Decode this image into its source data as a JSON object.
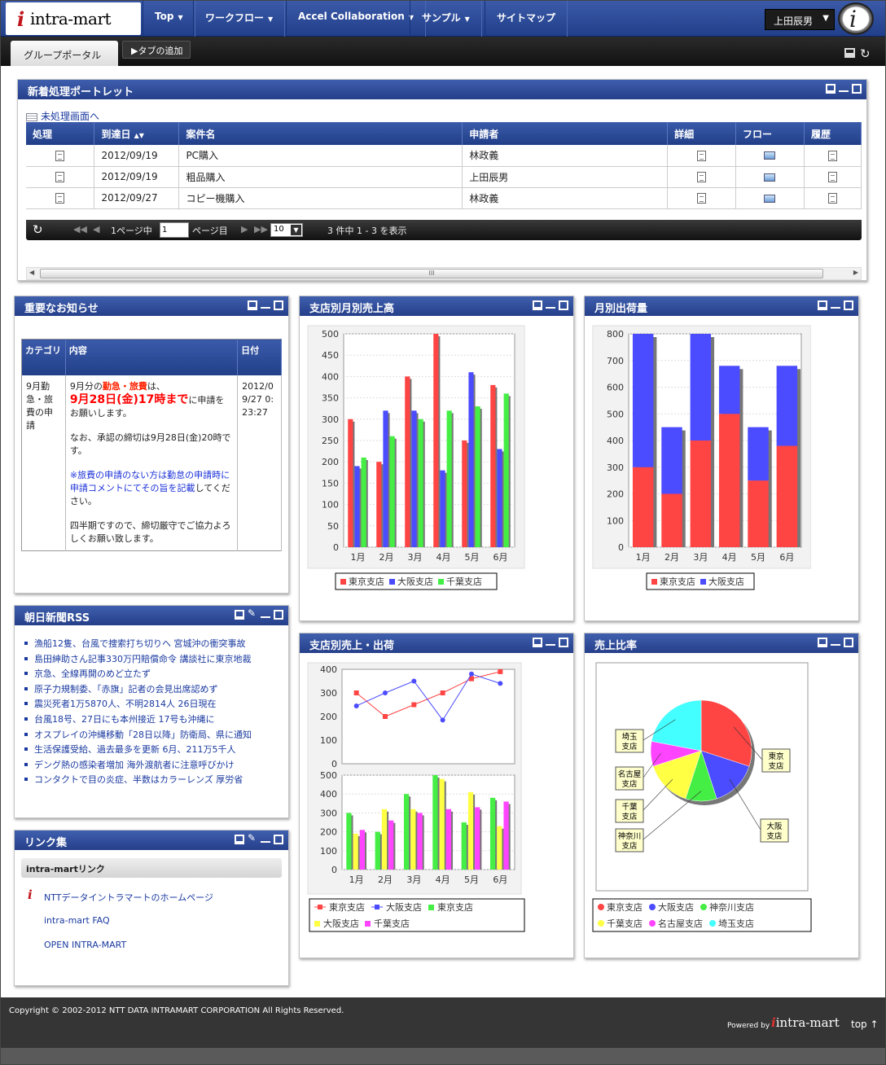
{
  "nav": {
    "logo": "intra-mart",
    "items": [
      "Top",
      "ワークフロー",
      "Accel Collaboration",
      "サンプル",
      "サイトマップ"
    ],
    "user": "上田辰男"
  },
  "tabs": {
    "portal": "グループポータル",
    "add": "▶タブの追加"
  },
  "pending": {
    "title": "新着処理ポートレット",
    "link": "未処理画面へ",
    "columns": [
      "処理",
      "到達日",
      "案件名",
      "申請者",
      "詳細",
      "フロー",
      "履歴"
    ],
    "rows": [
      {
        "date": "2012/09/19",
        "name": "PC購入",
        "applicant": "林政義"
      },
      {
        "date": "2012/09/19",
        "name": "粗品購入",
        "applicant": "上田辰男"
      },
      {
        "date": "2012/09/27",
        "name": "コピー機購入",
        "applicant": "林政義"
      }
    ],
    "pager": {
      "page_label": "1ページ中",
      "page_value": "1",
      "page_suffix": "ページ目",
      "per_page": "10",
      "summary": "3 件中 1 - 3 を表示"
    },
    "scroll_mark": "III"
  },
  "notice": {
    "title": "重要なお知らせ",
    "columns": [
      "カテゴリ",
      "内容",
      "日付"
    ],
    "category": "9月勤急・旅費の申請",
    "line1_a": "9月分の",
    "line1_b": "勤急・旅費",
    "line1_c": "は、",
    "line2_a": "9月28日(金)17時まで",
    "line2_b": "に申請をお願いします。",
    "para2": "なお、承認の締切は9月28日(金)20時です。",
    "para3": "※旅費の申請のない方は勤怠の申請時に申請コメントにてその旨を記載",
    "para3_b": "してください。",
    "para4": "四半期ですので、締切厳守でご協力よろしくお願い致します。",
    "date": "2012/09/27 0:23:27"
  },
  "rss": {
    "title": "朝日新聞RSS",
    "items": [
      "漁船12隻、台風で捜索打ち切りへ 宮城沖の衝突事故",
      "島田紳助さん記事330万円賠償命令 講談社に東京地裁",
      "京急、全線再開のめど立たず",
      "原子力規制委、「赤旗」記者の会見出席認めず",
      "震災死者1万5870人、不明2814人 26日現在",
      "台風18号、27日にも本州接近 17号も沖縄に",
      "オスプレイの沖縄移動「28日以降」防衛局、県に通知",
      "生活保護受給、過去最多を更新 6月、211万5千人",
      "デング熱の感染者増加 海外渡航者に注意呼びかけ",
      "コンタクトで目の炎症、半数はカラーレンズ 厚労省"
    ]
  },
  "links": {
    "title": "リンク集",
    "group": "intra-martリンク",
    "items": [
      "NTTデータイントラマートのホームページ",
      "intra-mart FAQ",
      "OPEN INTRA-MART"
    ]
  },
  "chart_titles": {
    "sales": "支店別月別売上高",
    "shipping": "月別出荷量",
    "combined": "支店別売上・出荷",
    "ratio": "売上比率"
  },
  "colors": {
    "red": "#ff4444",
    "blue": "#4b4bff",
    "green": "#44ee44",
    "yellow": "#ffff44",
    "magenta": "#ff44ff",
    "cyan": "#44ffff"
  },
  "chart_data": [
    {
      "type": "bar",
      "title": "支店別月別売上高",
      "categories": [
        "1月",
        "2月",
        "3月",
        "4月",
        "5月",
        "6月"
      ],
      "ylim": [
        0,
        500
      ],
      "yticks": [
        0,
        50,
        100,
        150,
        200,
        250,
        300,
        350,
        400,
        450,
        500
      ],
      "series": [
        {
          "name": "東京支店",
          "color": "#ff4444",
          "values": [
            300,
            200,
            400,
            500,
            250,
            380
          ]
        },
        {
          "name": "大阪支店",
          "color": "#4b4bff",
          "values": [
            190,
            320,
            320,
            180,
            410,
            230
          ]
        },
        {
          "name": "千葉支店",
          "color": "#44ee44",
          "values": [
            210,
            260,
            300,
            320,
            330,
            360
          ]
        }
      ],
      "legend": "bottom"
    },
    {
      "type": "bar",
      "stacked": true,
      "title": "月別出荷量",
      "categories": [
        "1月",
        "2月",
        "3月",
        "4月",
        "5月",
        "6月"
      ],
      "ylim": [
        0,
        800
      ],
      "yticks": [
        0,
        100,
        200,
        300,
        400,
        500,
        600,
        700,
        800
      ],
      "series": [
        {
          "name": "東京支店",
          "color": "#ff4444",
          "values": [
            300,
            200,
            400,
            500,
            250,
            380
          ]
        },
        {
          "name": "大阪支店",
          "color": "#4b4bff",
          "values": [
            500,
            250,
            400,
            180,
            200,
            300
          ]
        }
      ],
      "legend": "bottom"
    },
    {
      "type": "line",
      "title": "支店別売上・出荷",
      "categories": [
        "1月",
        "2月",
        "3月",
        "4月",
        "5月",
        "6月"
      ],
      "ylim": [
        0,
        400
      ],
      "yticks": [
        0,
        100,
        200,
        300,
        400
      ],
      "series": [
        {
          "name": "東京支店",
          "color": "#ff4444",
          "values": [
            300,
            200,
            250,
            300,
            360,
            390
          ]
        },
        {
          "name": "大阪支店",
          "color": "#4b4bff",
          "values": [
            245,
            300,
            350,
            185,
            380,
            340
          ]
        }
      ]
    },
    {
      "type": "bar",
      "categories": [
        "1月",
        "2月",
        "3月",
        "4月",
        "5月",
        "6月"
      ],
      "ylim": [
        0,
        500
      ],
      "yticks": [
        0,
        100,
        200,
        300,
        400,
        500
      ],
      "series": [
        {
          "name": "東京支店",
          "color": "#44ee44",
          "values": [
            300,
            200,
            400,
            500,
            250,
            380
          ]
        },
        {
          "name": "大阪支店",
          "color": "#ffff44",
          "values": [
            190,
            320,
            320,
            480,
            410,
            230
          ]
        },
        {
          "name": "千葉支店",
          "color": "#ff44ff",
          "values": [
            210,
            260,
            300,
            320,
            330,
            360
          ]
        }
      ],
      "legend_names": [
        "東京支店",
        "大阪支店",
        "東京支店",
        "大阪支店",
        "千葉支店"
      ]
    },
    {
      "type": "pie",
      "title": "売上比率",
      "slices": [
        {
          "name": "東京支店",
          "color": "#ff4444",
          "value": 30
        },
        {
          "name": "大阪支店",
          "color": "#4b4bff",
          "value": 15
        },
        {
          "name": "神奈川支店",
          "color": "#44ee44",
          "value": 10
        },
        {
          "name": "千葉支店",
          "color": "#ffff44",
          "value": 15
        },
        {
          "name": "名古屋支店",
          "color": "#ff44ff",
          "value": 8
        },
        {
          "name": "埼玉支店",
          "color": "#44ffff",
          "value": 22
        }
      ],
      "legend": "bottom"
    }
  ],
  "footer": {
    "copyright": "Copyright © 2002-2012 NTT DATA INTRAMART CORPORATION All Rights Reserved.",
    "powered": "Powered by",
    "logo": "intra-mart",
    "top_link": "top ↑"
  }
}
